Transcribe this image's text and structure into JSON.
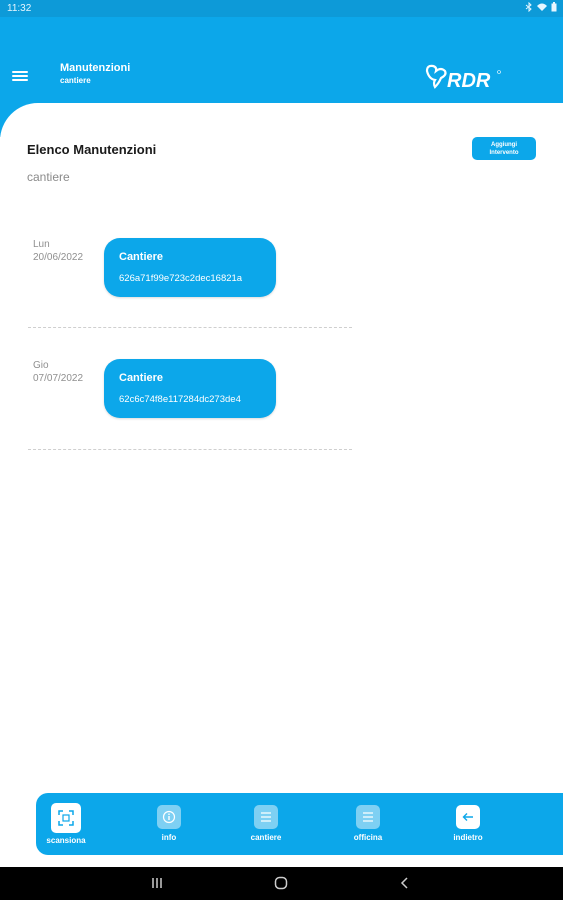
{
  "status_bar": {
    "time": "11:32"
  },
  "app_bar": {
    "title": "Manutenzioni",
    "subtitle": "cantiere",
    "logo_text": "RDR"
  },
  "list": {
    "title": "Elenco Manutenzioni",
    "subtitle": "cantiere",
    "add_button_line1": "Aggiungi",
    "add_button_line2": "Intervento",
    "items": [
      {
        "weekday": "Lun",
        "date": "20/06/2022",
        "title": "Cantiere",
        "id": "626a71f99e723c2dec16821a"
      },
      {
        "weekday": "Gio",
        "date": "07/07/2022",
        "title": "Cantiere",
        "id": "62c6c74f8e117284dc273de4"
      }
    ]
  },
  "bottom_nav": {
    "items": [
      {
        "label": "scansiona",
        "icon": "qr-scan-icon",
        "active": true
      },
      {
        "label": "info",
        "icon": "info-icon",
        "active": false
      },
      {
        "label": "cantiere",
        "icon": "list-icon",
        "active": false
      },
      {
        "label": "officina",
        "icon": "list-icon",
        "active": false
      },
      {
        "label": "indietro",
        "icon": "back-arrow-icon",
        "active": false
      }
    ]
  },
  "colors": {
    "primary": "#0ca7ea",
    "status_bar": "#0d9ad8",
    "background": "#ffffff",
    "muted_text": "#8f8f8f"
  }
}
